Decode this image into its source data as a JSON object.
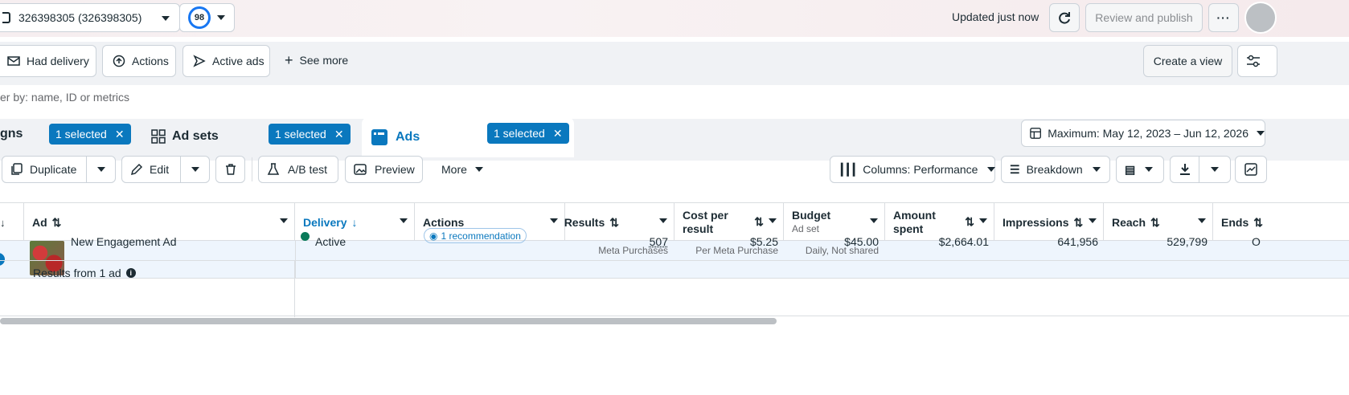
{
  "topbar": {
    "account_label": "326398305 (326398305)",
    "score": "98",
    "updated_text": "Updated just now",
    "review_label": "Review and publish"
  },
  "views": {
    "had_delivery": "Had delivery",
    "actions": "Actions",
    "active_ads": "Active ads",
    "see_more": "See more",
    "create_view": "Create a view"
  },
  "filter": {
    "placeholder": "er by: name, ID or metrics"
  },
  "tabs": {
    "campaigns_label": "gns",
    "campaigns_selected": "1 selected",
    "adsets_label": "Ad sets",
    "adsets_selected": "1 selected",
    "ads_label": "Ads",
    "ads_selected": "1 selected",
    "date_range": "Maximum: May 12, 2023 – Jun 12, 2026"
  },
  "toolbar": {
    "duplicate": "Duplicate",
    "edit": "Edit",
    "ab_test": "A/B test",
    "preview": "Preview",
    "more": "More",
    "columns": "Columns: Performance",
    "breakdown": "Breakdown"
  },
  "table": {
    "headers": {
      "ad": "Ad",
      "delivery": "Delivery",
      "actions": "Actions",
      "results": "Results",
      "cost_per_result_1": "Cost per",
      "cost_per_result_2": "result",
      "budget": "Budget",
      "budget_sub": "Ad set",
      "amount_spent_1": "Amount",
      "amount_spent_2": "spent",
      "impressions": "Impressions",
      "reach": "Reach",
      "ends": "Ends"
    },
    "row": {
      "ad_name": "New Engagement Ad",
      "delivery": "Active",
      "recommendation": "1 recommendation",
      "results": "507",
      "results_sub": "Meta Purchases",
      "cost_per_result": "$5.25",
      "cost_sub": "Per Meta Purchase",
      "budget": "$45.00",
      "budget_sub": "Daily, Not shared",
      "amount_spent": "$2,664.01",
      "impressions": "641,956",
      "reach": "529,799",
      "ends": "O"
    },
    "summary": "Results from 1 ad"
  },
  "colors": {
    "accent": "#0a78be",
    "active_dot": "#0a7a5a",
    "selected_row": "#eef5fd"
  }
}
